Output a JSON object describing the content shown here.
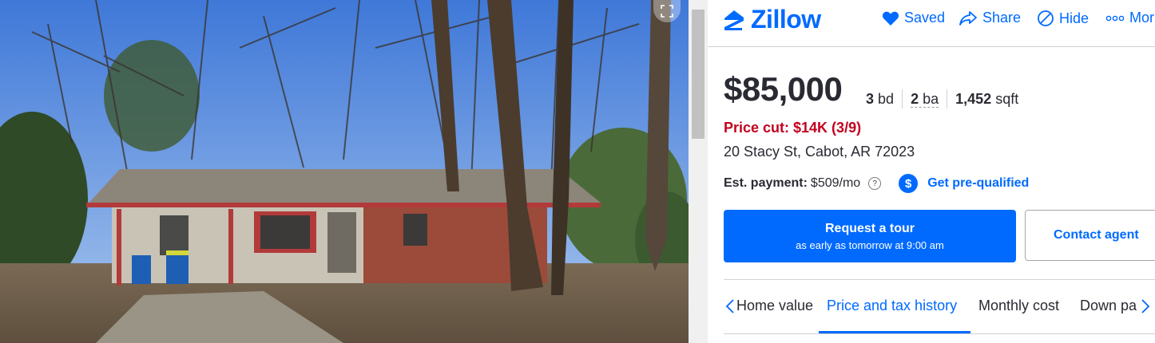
{
  "brand": {
    "name": "Zillow",
    "color": "#006aff"
  },
  "header_actions": [
    {
      "label": "Saved",
      "icon": "heart-icon"
    },
    {
      "label": "Share",
      "icon": "share-icon"
    },
    {
      "label": "Hide",
      "icon": "hide-icon"
    },
    {
      "label": "Mor",
      "icon": "more-icon"
    }
  ],
  "listing": {
    "price": "$85,000",
    "beds_num": "3",
    "beds_unit": "bd",
    "baths_num": "2",
    "baths_unit": "ba",
    "sqft_num": "1,452",
    "sqft_unit": "sqft",
    "price_cut": "Price cut: $14K (3/9)",
    "address": "20 Stacy St, Cabot, AR 72023",
    "est_payment_label": "Est. payment:",
    "est_payment_value": "$509/mo",
    "help_glyph": "?",
    "dollar_glyph": "$",
    "prequal_label": "Get pre-qualified"
  },
  "actions": {
    "tour_title": "Request a tour",
    "tour_subtitle": "as early as tomorrow at 9:00 am",
    "contact_label": "Contact agent"
  },
  "tabs": [
    {
      "label": "Home value",
      "active": false
    },
    {
      "label": "Price and tax history",
      "active": true
    },
    {
      "label": "Monthly cost",
      "active": false
    },
    {
      "label": "Down pa",
      "active": false
    }
  ],
  "colors": {
    "accent": "#006aff",
    "price_cut": "#c2001e",
    "text": "#2a2a33"
  }
}
